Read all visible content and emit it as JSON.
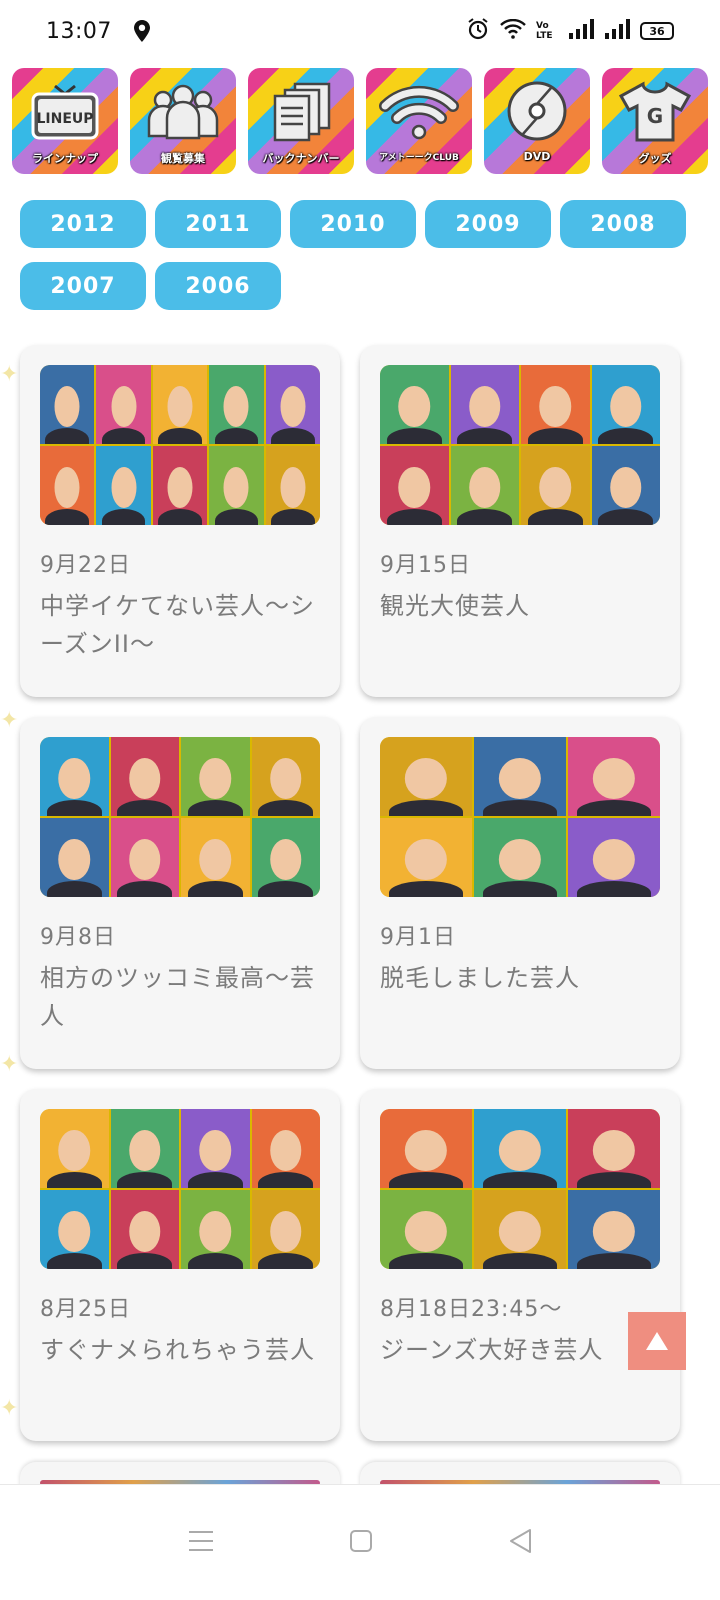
{
  "status_bar": {
    "time": "13:07",
    "battery": "36",
    "network": "Vo LTE"
  },
  "nav_tiles": [
    {
      "id": "lineup",
      "icon": "tv-lineup-icon",
      "icon_text": "LINEUP",
      "label": "ラインナップ"
    },
    {
      "id": "audience",
      "icon": "audience-icon",
      "label": "観覧募集"
    },
    {
      "id": "backnumber",
      "icon": "documents-icon",
      "label": "バックナンバー"
    },
    {
      "id": "club",
      "icon": "wifi-icon",
      "label": "アメトーークCLUB"
    },
    {
      "id": "dvd",
      "icon": "disc-icon",
      "label": "DVD"
    },
    {
      "id": "goods",
      "icon": "tshirt-icon",
      "icon_text": "G",
      "label": "グッズ"
    }
  ],
  "years": [
    "2012",
    "2011",
    "2010",
    "2009",
    "2008",
    "2007",
    "2006"
  ],
  "episodes": [
    {
      "date": "9月22日",
      "title": "中学イケてない芸人〜シーズンII〜",
      "faces": 10
    },
    {
      "date": "9月15日",
      "title": "観光大使芸人",
      "faces": 8
    },
    {
      "date": "9月8日",
      "title": "相方のツッコミ最高〜芸人",
      "faces": 8
    },
    {
      "date": "9月1日",
      "title": "脱毛しました芸人",
      "faces": 6
    },
    {
      "date": "8月25日",
      "title": "すぐナメられちゃう芸人",
      "faces": 8
    },
    {
      "date": "8月18日23:45〜",
      "title": "ジーンズ大好き芸人",
      "faces": 6
    }
  ],
  "scroll_top": {
    "icon": "arrow-up-icon"
  },
  "system_nav": [
    "menu-icon",
    "home-icon",
    "back-icon"
  ],
  "colors": {
    "pill": "#4bbde8",
    "card": "#f6f6f6",
    "text": "#7b7b7b",
    "scroll_top": "#ef8e80"
  }
}
